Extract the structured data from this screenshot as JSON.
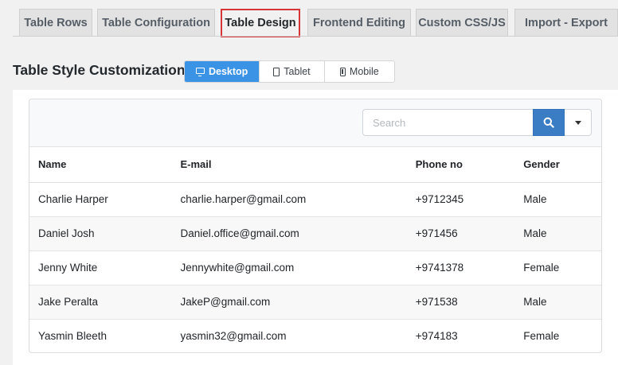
{
  "tabs": [
    {
      "label": "Table Rows",
      "active": false
    },
    {
      "label": "Table Configuration",
      "active": false
    },
    {
      "label": "Table Design",
      "active": true
    },
    {
      "label": "Frontend Editing",
      "active": false
    },
    {
      "label": "Custom CSS/JS",
      "active": false
    },
    {
      "label": "Import - Export",
      "active": false
    }
  ],
  "section": {
    "title": "Table Style Customization"
  },
  "devices": [
    {
      "label": "Desktop",
      "icon": "desktop-icon",
      "active": true
    },
    {
      "label": "Tablet",
      "icon": "tablet-icon",
      "active": false
    },
    {
      "label": "Mobile",
      "icon": "mobile-icon",
      "active": false
    }
  ],
  "search": {
    "placeholder": "Search",
    "value": ""
  },
  "table": {
    "headers": [
      "Name",
      "E-mail",
      "Phone no",
      "Gender"
    ],
    "rows": [
      [
        "Charlie Harper",
        "charlie.harper@gmail.com",
        "+9712345",
        "Male"
      ],
      [
        "Daniel Josh",
        "Daniel.office@gmail.com",
        "+971456",
        "Male"
      ],
      [
        "Jenny White",
        "Jennywhite@gmail.com",
        "+9741378",
        "Female"
      ],
      [
        "Jake Peralta",
        "JakeP@gmail.com",
        "+971538",
        "Male"
      ],
      [
        "Yasmin Bleeth",
        "yasmin32@gmail.com",
        "+974183",
        "Female"
      ]
    ]
  },
  "colors": {
    "accent": "#3b93e6",
    "search_button": "#3b7dc4",
    "active_tab_border": "#d63638"
  }
}
